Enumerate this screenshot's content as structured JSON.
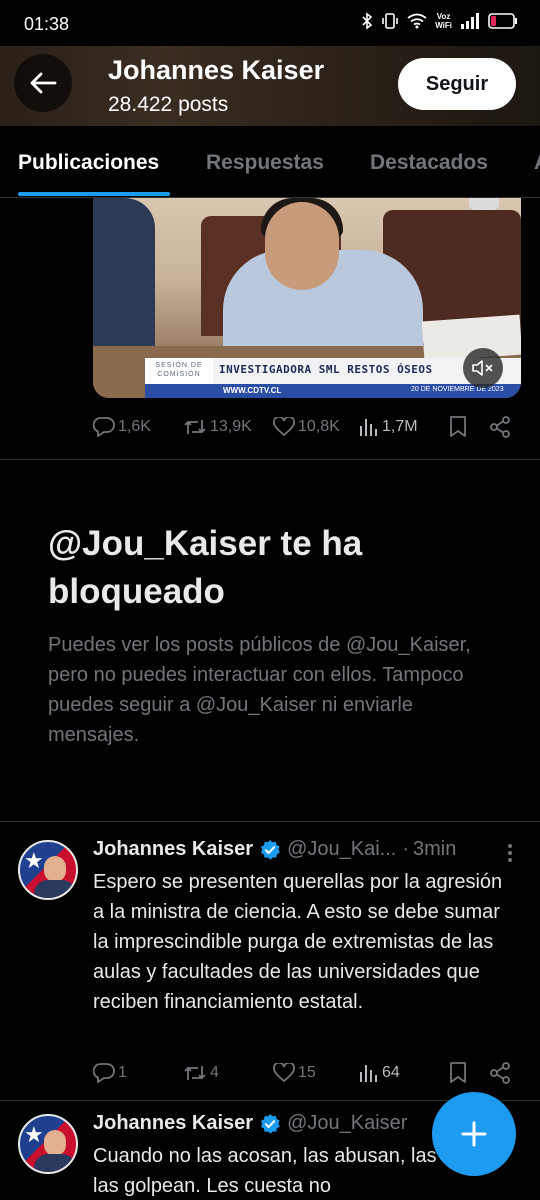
{
  "status_bar": {
    "time": "01:38",
    "voz_top": "Voz",
    "voz_bottom": "WiFi"
  },
  "header": {
    "name": "Johannes Kaiser",
    "posts": "28.422 posts",
    "follow_label": "Seguir",
    "background_color": "#2a2018"
  },
  "tabs": [
    {
      "label": "Publicaciones",
      "active": true
    },
    {
      "label": "Respuestas",
      "active": false
    },
    {
      "label": "Destacados",
      "active": false
    },
    {
      "label": "A",
      "active": false
    }
  ],
  "media_post": {
    "video": {
      "tag": "SESIÓN DE COMISIÓN",
      "headline": "INVESTIGADORA SML RESTOS ÓSEOS",
      "site": "WWW.CDTV.CL",
      "date": "20 DE NOVIEMBRE DE 2023",
      "mute_icon": "speaker-muted-icon"
    },
    "actions": {
      "replies": "1,6K",
      "reposts": "13,9K",
      "likes": "10,8K",
      "views": "1,7M"
    }
  },
  "blocked": {
    "title": "@Jou_Kaiser te ha bloqueado",
    "description": "Puedes ver los posts públicos de @Jou_Kaiser, pero no puedes interactuar con ellos. Tampoco puedes seguir a @Jou_Kaiser ni enviarle mensajes."
  },
  "tweets": [
    {
      "name": "Johannes Kaiser",
      "handle": "@Jou_Kai...",
      "dot": "·",
      "time": "3min",
      "text": "Espero se presenten querellas por la agresión a la ministra de ciencia.  A esto se debe sumar la imprescindible purga de extremistas de las aulas y facultades de las universidades que reciben financiamiento estatal.",
      "actions": {
        "replies": "1",
        "reposts": "4",
        "likes": "15",
        "views": "64"
      }
    },
    {
      "name": "Johannes Kaiser",
      "handle": "@Jou_Kaiser",
      "text": "Cuando no las acosan,  las abusan, las violan, las golpean. Les cuesta no"
    }
  ],
  "colors": {
    "accent": "#1d9bf0",
    "muted": "#71767b",
    "text": "#e7e9ea",
    "background": "#000000",
    "divider": "#2f3336"
  }
}
